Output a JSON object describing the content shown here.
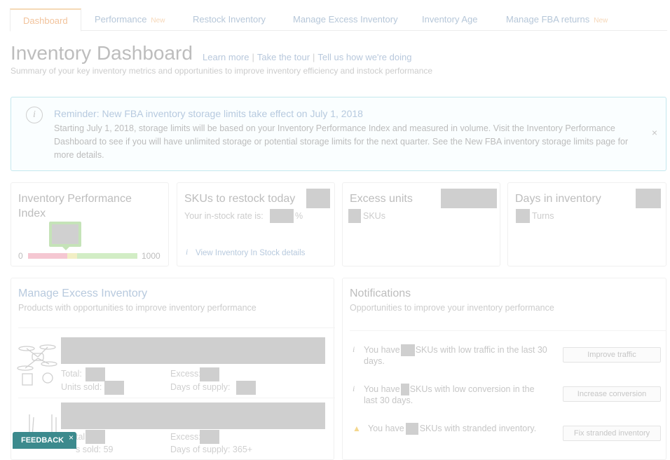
{
  "tabs": [
    {
      "label": "Dashboard",
      "badge": ""
    },
    {
      "label": "Performance",
      "badge": "New"
    },
    {
      "label": "Restock Inventory",
      "badge": ""
    },
    {
      "label": "Manage Excess Inventory",
      "badge": ""
    },
    {
      "label": "Inventory Age",
      "badge": ""
    },
    {
      "label": "Manage FBA returns",
      "badge": "New"
    }
  ],
  "header": {
    "title": "Inventory Dashboard",
    "links": [
      "Learn more",
      "Take the tour",
      "Tell us how we're doing"
    ],
    "subtitle": "Summary of your key inventory metrics and opportunities to improve inventory efficiency and instock performance"
  },
  "alert": {
    "title": "Reminder: New FBA inventory storage limits take effect on July 1, 2018",
    "body": "Starting July 1, 2018, storage limits will be based on your Inventory Performance Index and measured in volume. Visit the Inventory Performance Dashboard to see if you will have unlimited storage or potential storage limits for the next quarter. See the New FBA inventory storage limits page for more details.",
    "close": "×"
  },
  "cards": {
    "ipi": {
      "title": "Inventory Performance Index",
      "min": "0",
      "max": "1000"
    },
    "restock": {
      "title": "SKUs to restock today",
      "instock_label": "Your in-stock rate is:",
      "percent": "%",
      "link": "View Inventory In Stock details"
    },
    "excess": {
      "title": "Excess units",
      "skus": "SKUs"
    },
    "days": {
      "title": "Days in inventory",
      "turns": "Turns"
    }
  },
  "excess_section": {
    "title": "Manage Excess Inventory",
    "subtitle": "Products with opportunities to improve inventory performance",
    "row1": {
      "total": "Total:",
      "excess": "Excess:",
      "units_sold": "Units sold:",
      "days_supply": "Days of supply:"
    },
    "row2": {
      "total": "tal:",
      "excess": "Excess:",
      "units_sold": "s sold: 59",
      "days_supply": "Days of supply: 365+"
    }
  },
  "notifications": {
    "title": "Notifications",
    "subtitle": "Opportunities to improve your inventory performance",
    "items": [
      {
        "prefix": "You have",
        "text": "SKUs with low traffic in the last 30 days.",
        "button": "Improve traffic"
      },
      {
        "prefix": "You have",
        "text": "SKUs with low conversion in the last 30 days.",
        "button": "Increase conversion"
      },
      {
        "prefix": "You have",
        "text": "SKUs with stranded inventory.",
        "button": "Fix stranded inventory"
      }
    ]
  },
  "feedback": {
    "label": "FEEDBACK",
    "close": "×"
  },
  "colors": {
    "tab_active": "#f2c39c",
    "link": "#b8cade",
    "alert_border": "#c5e8ee",
    "feedback_bg": "#3c8a8d"
  }
}
